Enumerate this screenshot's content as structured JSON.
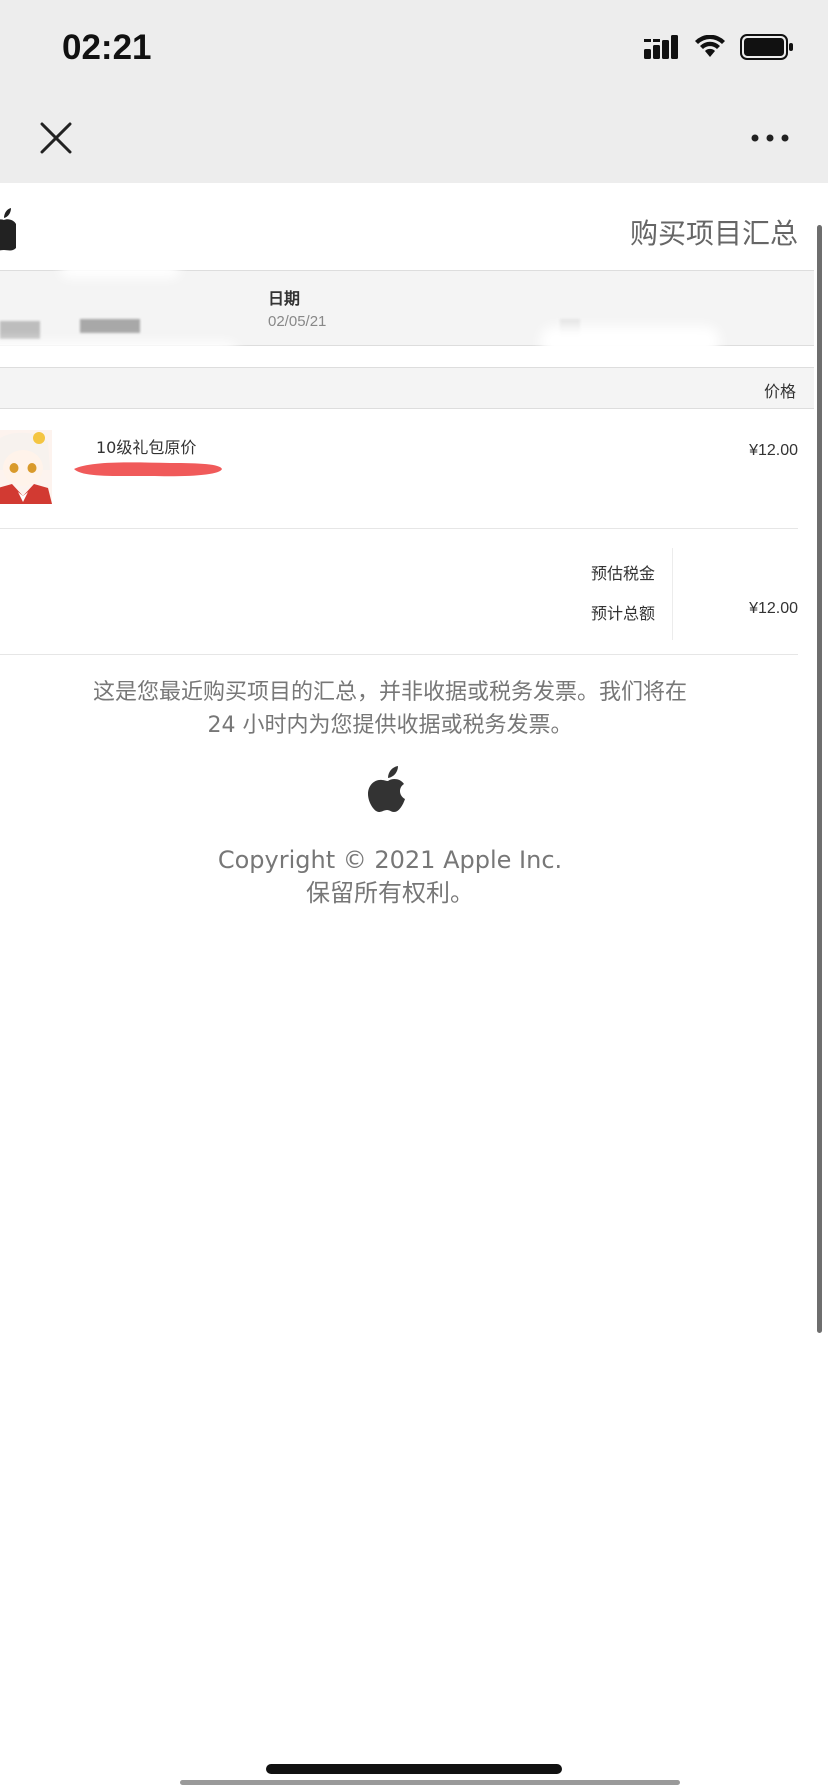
{
  "status_bar": {
    "time": "02:21",
    "icons": [
      "cellular-signal-icon",
      "wifi-icon",
      "battery-icon"
    ]
  },
  "nav": {
    "close_icon": "close-icon",
    "more_icon": "more-icon"
  },
  "receipt": {
    "title": "购买项目汇总",
    "date_label": "日期",
    "date_value": "02/05/21",
    "price_header": "价格",
    "item": {
      "name": "10级礼包原价",
      "price": "¥12.00"
    },
    "tax_label": "预估税金",
    "total_label": "预计总额",
    "total_value": "¥12.00"
  },
  "footer": {
    "notice_line1": "这是您最近购买项目的汇总，并非收据或税务发票。我们将在",
    "notice_line2": "24 小时内为您提供收据或税务发票。",
    "copyright_line1": "Copyright © 2021 Apple Inc.",
    "copyright_line2": "保留所有权利。"
  },
  "colors": {
    "top_bar_bg": "#ededed",
    "band_bg": "#f4f4f4",
    "redaction": "#f05a5a"
  }
}
